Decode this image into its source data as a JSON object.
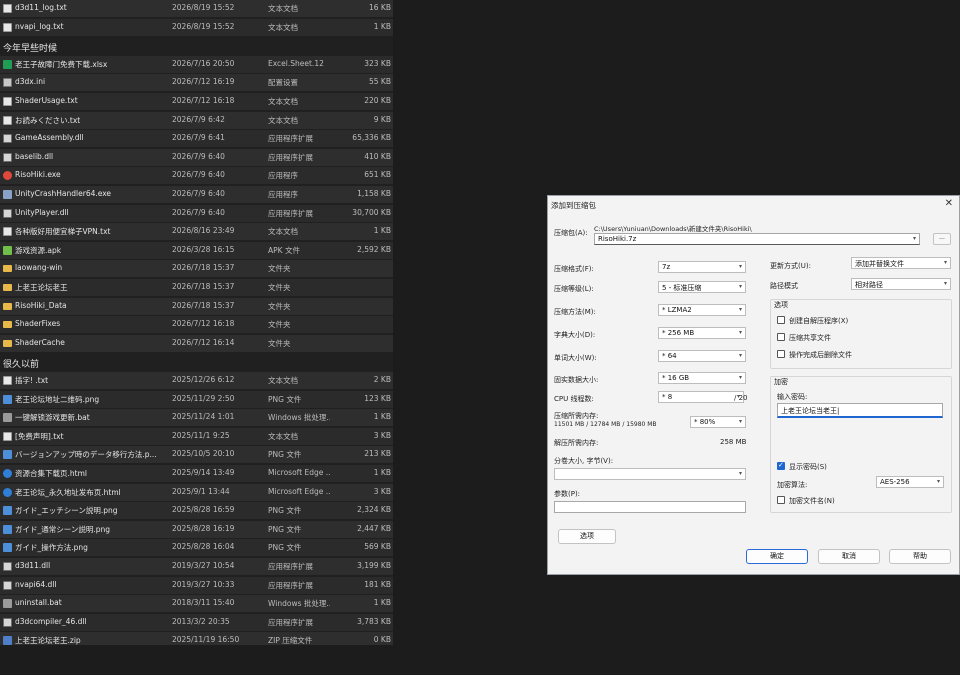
{
  "explorer": {
    "top_rows": [
      {
        "name": "d3d11_log.txt",
        "date": "2026/8/19 15:52",
        "type": "文本文档",
        "size": "16 KB",
        "icon": "txt"
      },
      {
        "name": "nvapi_log.txt",
        "date": "2026/8/19 15:52",
        "type": "文本文档",
        "size": "1 KB",
        "icon": "txt"
      }
    ],
    "group1": "今年早些时候",
    "group1_rows": [
      {
        "name": "老王子故障门免费下载.xlsx",
        "date": "2026/7/16 20:50",
        "type": "Excel.Sheet.12",
        "size": "323 KB",
        "icon": "xls"
      },
      {
        "name": "d3dx.ini",
        "date": "2026/7/12 16:19",
        "type": "配置设置",
        "size": "55 KB",
        "icon": "ini"
      },
      {
        "name": "ShaderUsage.txt",
        "date": "2026/7/12 16:18",
        "type": "文本文档",
        "size": "220 KB",
        "icon": "txt"
      },
      {
        "name": "お読みください.txt",
        "date": "2026/7/9 6:42",
        "type": "文本文档",
        "size": "9 KB",
        "icon": "txt"
      },
      {
        "name": "GameAssembly.dll",
        "date": "2026/7/9 6:41",
        "type": "应用程序扩展",
        "size": "65,336 KB",
        "icon": "dll"
      },
      {
        "name": "baselib.dll",
        "date": "2026/7/9 6:40",
        "type": "应用程序扩展",
        "size": "410 KB",
        "icon": "dll"
      },
      {
        "name": "RisoHiki.exe",
        "date": "2026/7/9 6:40",
        "type": "应用程序",
        "size": "651 KB",
        "icon": "exe2"
      },
      {
        "name": "UnityCrashHandler64.exe",
        "date": "2026/7/9 6:40",
        "type": "应用程序",
        "size": "1,158 KB",
        "icon": "exe"
      },
      {
        "name": "UnityPlayer.dll",
        "date": "2026/7/9 6:40",
        "type": "应用程序扩展",
        "size": "30,700 KB",
        "icon": "dll"
      },
      {
        "name": "各种版好用便宜梯子VPN.txt",
        "date": "2026/8/16 23:49",
        "type": "文本文档",
        "size": "1 KB",
        "icon": "txt"
      },
      {
        "name": "游戏资源.apk",
        "date": "2026/3/28 16:15",
        "type": "APK 文件",
        "size": "2,592 KB",
        "icon": "apk"
      },
      {
        "name": "laowang-win",
        "date": "2026/7/18 15:37",
        "type": "文件夹",
        "size": "",
        "icon": "folder"
      },
      {
        "name": "上老王论坛老王",
        "date": "2026/7/18 15:37",
        "type": "文件夹",
        "size": "",
        "icon": "folder"
      },
      {
        "name": "RisoHiki_Data",
        "date": "2026/7/18 15:37",
        "type": "文件夹",
        "size": "",
        "icon": "folder"
      },
      {
        "name": "ShaderFixes",
        "date": "2026/7/12 16:18",
        "type": "文件夹",
        "size": "",
        "icon": "folder"
      },
      {
        "name": "ShaderCache",
        "date": "2026/7/12 16:14",
        "type": "文件夹",
        "size": "",
        "icon": "folder"
      }
    ],
    "group2": "很久以前",
    "group2_rows": [
      {
        "name": "插字! .txt",
        "date": "2025/12/26 6:12",
        "type": "文本文档",
        "size": "2 KB",
        "icon": "txt"
      },
      {
        "name": "老王论坛地址二维码.png",
        "date": "2025/11/29 2:50",
        "type": "PNG 文件",
        "size": "123 KB",
        "icon": "png"
      },
      {
        "name": "一键解锁游戏更新.bat",
        "date": "2025/11/24 1:01",
        "type": "Windows 批处理...",
        "size": "1 KB",
        "icon": "bat"
      },
      {
        "name": "[免费声明].txt",
        "date": "2025/11/1 9:25",
        "type": "文本文档",
        "size": "3 KB",
        "icon": "txt"
      },
      {
        "name": "バージョンアップ時のデータ移行方法.p...",
        "date": "2025/10/5 20:10",
        "type": "PNG 文件",
        "size": "213 KB",
        "icon": "png"
      },
      {
        "name": "资源合集下载页.html",
        "date": "2025/9/14 13:49",
        "type": "Microsoft Edge ...",
        "size": "1 KB",
        "icon": "html"
      },
      {
        "name": "老王论坛_永久地址发布页.html",
        "date": "2025/9/1 13:44",
        "type": "Microsoft Edge ...",
        "size": "3 KB",
        "icon": "html"
      },
      {
        "name": "ガイド_エッチシーン説明.png",
        "date": "2025/8/28 16:59",
        "type": "PNG 文件",
        "size": "2,324 KB",
        "icon": "png"
      },
      {
        "name": "ガイド_通常シーン説明.png",
        "date": "2025/8/28 16:19",
        "type": "PNG 文件",
        "size": "2,447 KB",
        "icon": "png"
      },
      {
        "name": "ガイド_操作方法.png",
        "date": "2025/8/28 16:04",
        "type": "PNG 文件",
        "size": "569 KB",
        "icon": "png"
      },
      {
        "name": "d3d11.dll",
        "date": "2019/3/27 10:54",
        "type": "应用程序扩展",
        "size": "3,199 KB",
        "icon": "dll"
      },
      {
        "name": "nvapi64.dll",
        "date": "2019/3/27 10:33",
        "type": "应用程序扩展",
        "size": "181 KB",
        "icon": "dll"
      },
      {
        "name": "uninstall.bat",
        "date": "2018/3/11 15:40",
        "type": "Windows 批处理...",
        "size": "1 KB",
        "icon": "bat"
      },
      {
        "name": "d3dcompiler_46.dll",
        "date": "2013/3/2 20:35",
        "type": "应用程序扩展",
        "size": "3,783 KB",
        "icon": "dll"
      },
      {
        "name": "上老王论坛老王.zip",
        "date": "2025/11/19 16:50",
        "type": "ZIP 压缩文件",
        "size": "0 KB",
        "icon": "zip"
      }
    ]
  },
  "dialog": {
    "title": "添加到压缩包",
    "close": "✕",
    "archive_label": "压缩包(A):",
    "archive_dir": "C:\\Users\\Yuniuan\\Downloads\\新建文件夹\\RisoHiki\\",
    "archive_name": "RisoHiki.7z",
    "browse": "...",
    "left": [
      {
        "label": "压缩格式(F):",
        "value": "7z"
      },
      {
        "label": "压缩等级(L):",
        "value": "5 - 标准压缩"
      },
      {
        "label": "压缩方法(M):",
        "value": "* LZMA2"
      },
      {
        "label": "字典大小(D):",
        "value": "* 256 MB"
      },
      {
        "label": "单词大小(W):",
        "value": "* 64"
      },
      {
        "label": "固实数据大小:",
        "value": "* 16 GB"
      }
    ],
    "cpu_label": "CPU 线程数:",
    "cpu_value": "* 8",
    "cpu_total": "/ 20",
    "mem_label": "压缩所需内存:",
    "mem_detail": "11501 MB / 12784 MB / 15980 MB",
    "mem_pct": "* 80%",
    "decomp_label": "解压所需内存:",
    "decomp_value": "258 MB",
    "split_label": "分卷大小, 字节(V):",
    "param_label": "参数(P):",
    "options_btn": "选项",
    "update_label": "更新方式(U):",
    "update_value": "添加并替换文件",
    "path_label": "路径模式",
    "path_value": "相对路径",
    "options_group": "选项",
    "opt1": "创建自解压程序(X)",
    "opt2": "压缩共享文件",
    "opt3": "操作完成后删除文件",
    "enc_group": "加密",
    "pwd_label": "输入密码:",
    "pwd_value": "上老王论坛当老王|",
    "show_pwd": "显示密码(S)",
    "enc_method_label": "加密算法:",
    "enc_method_value": "AES-256",
    "enc_names": "加密文件名(N)",
    "ok": "确定",
    "cancel": "取消",
    "help": "帮助"
  }
}
